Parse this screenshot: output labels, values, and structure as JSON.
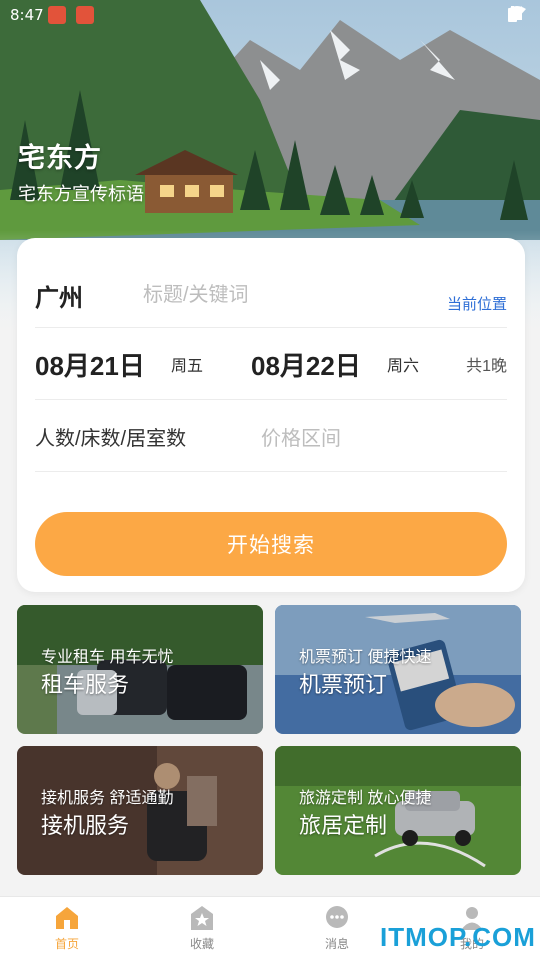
{
  "status_bar": {
    "time": "8:47"
  },
  "hero": {
    "title": "宅东方",
    "slogan": "宅东方宣传标语"
  },
  "search": {
    "city": "广州",
    "keyword_placeholder": "标题/关键词",
    "location_link": "当前位置",
    "checkin_date": "08月21日",
    "checkin_weekday": "周五",
    "checkout_date": "08月22日",
    "checkout_weekday": "周六",
    "nights": "共1晚",
    "guests_label": "人数/床数/居室数",
    "price_placeholder": "价格区间",
    "search_button": "开始搜索"
  },
  "services": [
    {
      "subtitle": "专业租车 用车无忧",
      "title": "租车服务"
    },
    {
      "subtitle": "机票预订 便捷快速",
      "title": "机票预订"
    },
    {
      "subtitle": "接机服务 舒适通勤",
      "title": "接机服务"
    },
    {
      "subtitle": "旅游定制 放心便捷",
      "title": "旅居定制"
    }
  ],
  "tabbar": [
    {
      "label": "首页",
      "icon": "home-icon",
      "active": true
    },
    {
      "label": "收藏",
      "icon": "star-icon",
      "active": false
    },
    {
      "label": "消息",
      "icon": "message-icon",
      "active": false
    },
    {
      "label": "我的",
      "icon": "user-icon",
      "active": false
    }
  ],
  "watermark": "ITMOP.COM",
  "colors": {
    "accent": "#fca845",
    "link": "#2f6fd6",
    "active_tab": "#f6a53b"
  }
}
